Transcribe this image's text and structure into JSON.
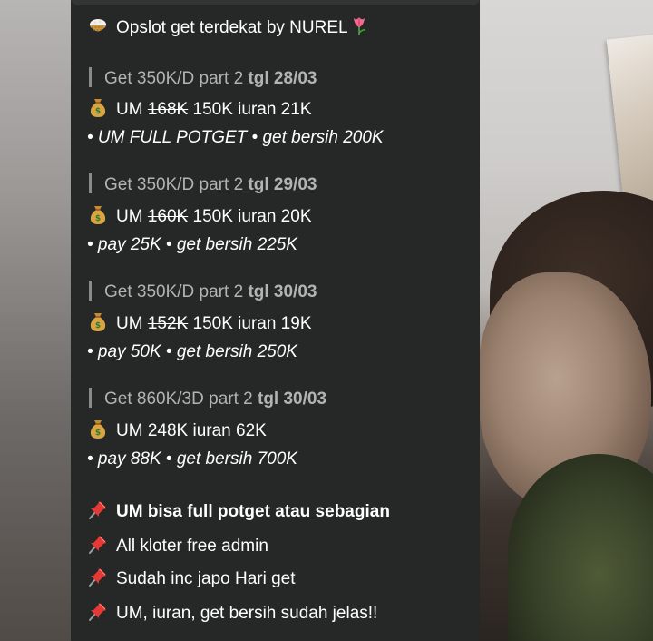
{
  "header": {
    "emoji": "rice-bowl-icon",
    "title": "Opslot get terdekat by NUREL",
    "trailing_emoji": "tulip-icon"
  },
  "slots": [
    {
      "heading": "Get 350K/D part 2",
      "date": "tgl 28/03",
      "um_label": "UM",
      "um_old": "168K",
      "um_rest": "150K iuran 21K",
      "detail": "• UM FULL POTGET • get bersih 200K"
    },
    {
      "heading": "Get 350K/D part 2",
      "date": "tgl 29/03",
      "um_label": "UM",
      "um_old": "160K",
      "um_rest": "150K iuran 20K",
      "detail": "• pay 25K • get bersih 225K"
    },
    {
      "heading": "Get 350K/D part 2",
      "date": "tgl 30/03",
      "um_label": "UM",
      "um_old": "152K",
      "um_rest": "150K iuran 19K",
      "detail": "• pay 50K • get bersih 250K"
    },
    {
      "heading": "Get 860K/3D part 2",
      "date": "tgl 30/03",
      "um_label": "UM",
      "um_old": "",
      "um_rest": "248K iuran 62K",
      "detail": "• pay 88K • get bersih 700K"
    }
  ],
  "notes": [
    {
      "icon": "pushpin-icon",
      "text": "UM bisa full potget atau sebagian",
      "bold": true
    },
    {
      "icon": "pushpin-icon",
      "text": "All kloter free admin",
      "bold": false
    },
    {
      "icon": "pushpin-icon",
      "text": "Sudah inc japo Hari get",
      "bold": false
    },
    {
      "icon": "pushpin-icon",
      "text": "UM, iuran, get bersih sudah jelas!!",
      "bold": false
    }
  ],
  "colors": {
    "bubble": "#262727",
    "text": "#ffffff",
    "muted": "#b3b3b3",
    "quote_bar": "#8a8a8a"
  }
}
